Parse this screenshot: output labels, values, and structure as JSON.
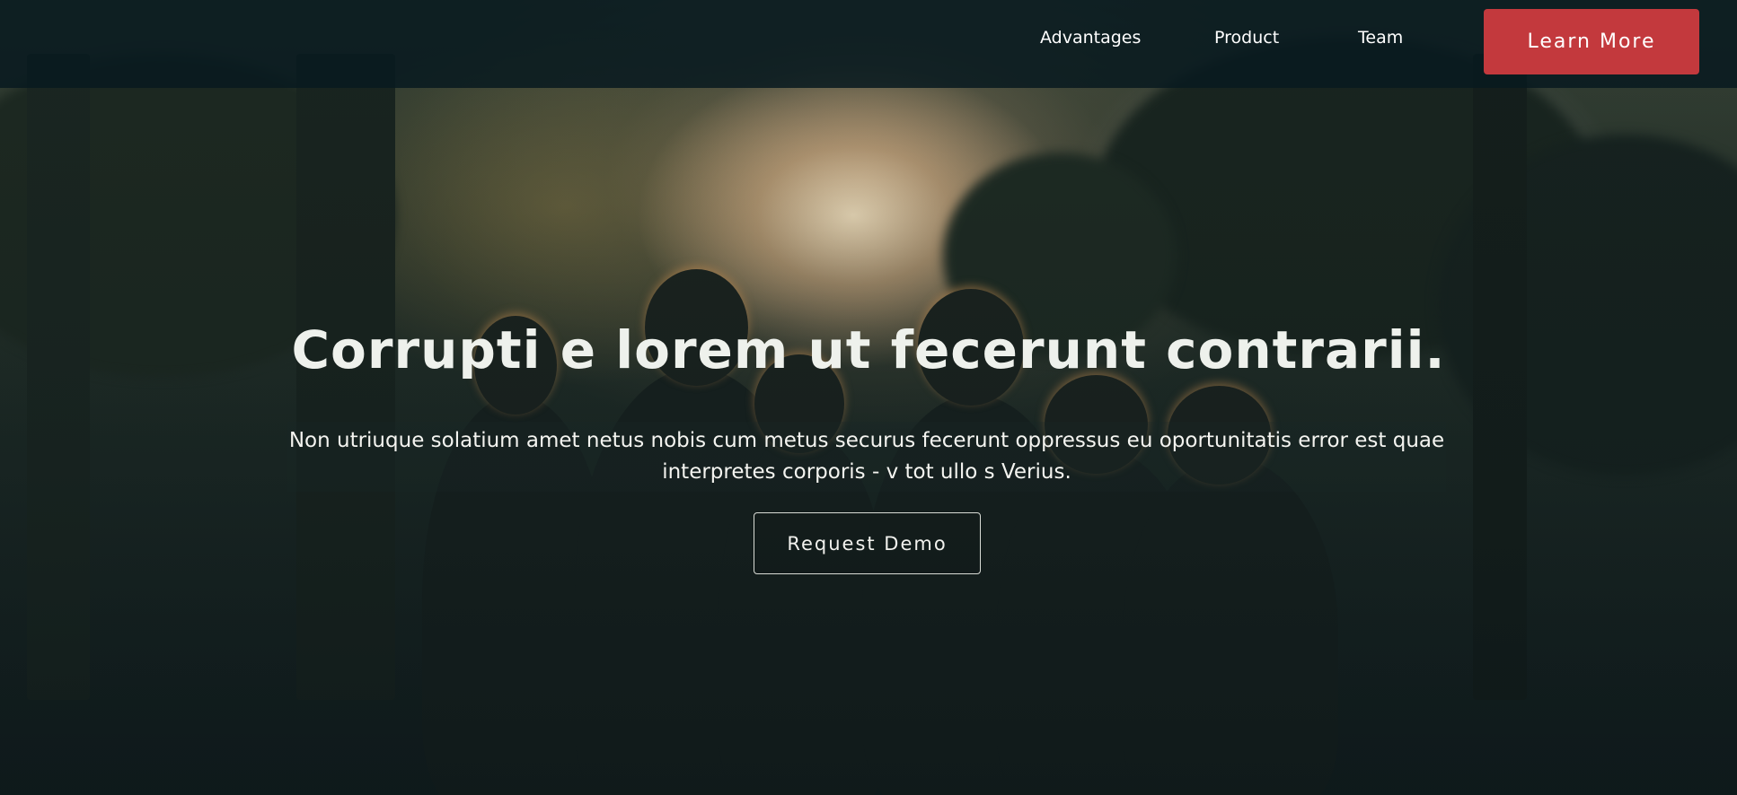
{
  "nav": {
    "links": [
      {
        "label": "Advantages"
      },
      {
        "label": "Product"
      },
      {
        "label": "Team"
      }
    ],
    "cta_label": "Learn More",
    "cta_color": "#c3393d"
  },
  "hero": {
    "title": "Corrupti e lorem ut fecerunt contrarii.",
    "subtitle": "Non utriuque solatium amet netus nobis cum metus securus fecerunt oppressus eu oportunitatis error est quae interpretes corporis - v tot ullo s Verius.",
    "button_label": "Request Demo",
    "background_image": "group of people silhouetted among trees at sunset"
  }
}
